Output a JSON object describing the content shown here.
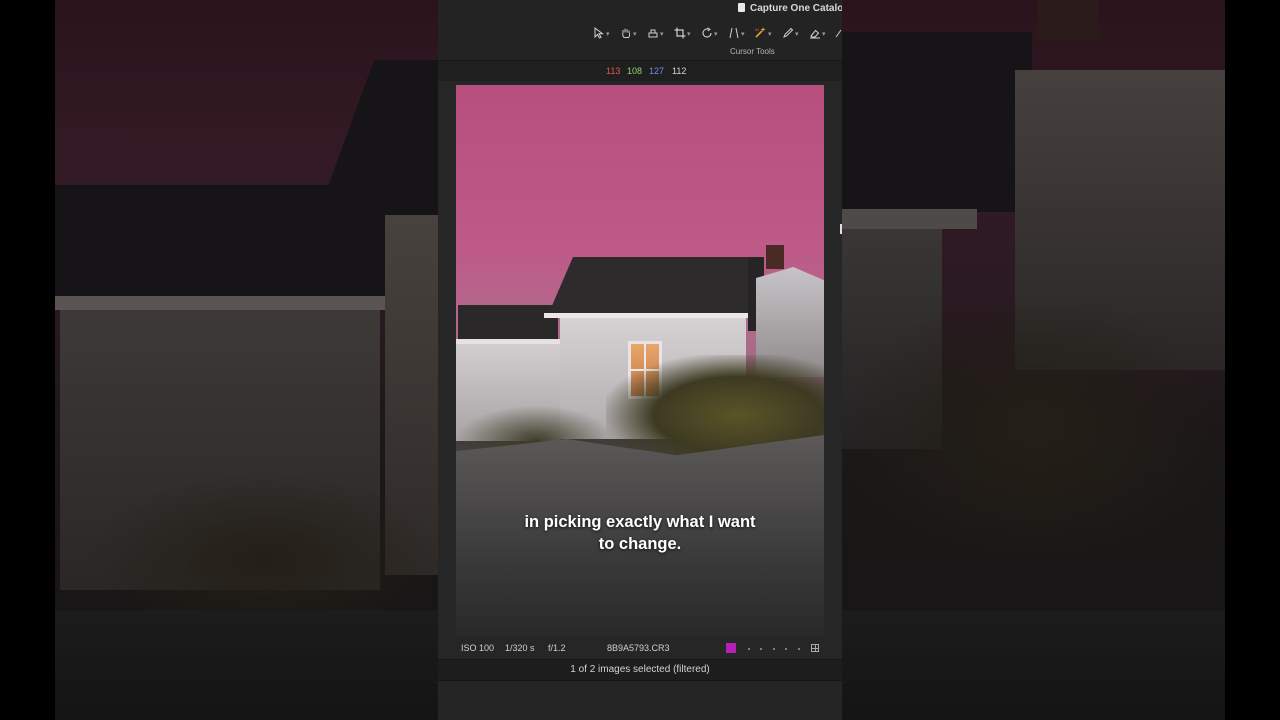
{
  "app": {
    "window_title": "Capture One Catalo"
  },
  "toolbar": {
    "caption": "Cursor Tools",
    "tools": [
      {
        "name": "select-cursor-icon"
      },
      {
        "name": "pan-hand-icon"
      },
      {
        "name": "stamp-icon"
      },
      {
        "name": "crop-icon"
      },
      {
        "name": "rotate-icon"
      },
      {
        "name": "keystone-icon"
      },
      {
        "name": "ai-magic-wand-icon"
      },
      {
        "name": "brush-icon"
      },
      {
        "name": "eraser-icon"
      }
    ]
  },
  "readout": {
    "r": "113",
    "g": "108",
    "b": "127",
    "l": "112",
    "colors": {
      "r": "#e0574f",
      "g": "#8cd66a",
      "b": "#6f8ee6",
      "l": "#d6d6d6"
    }
  },
  "photo": {
    "subtitle_line1": "in picking exactly what I want",
    "subtitle_line2": "to change."
  },
  "image_info": {
    "iso": "ISO 100",
    "shutter": "1/320 s",
    "aperture": "f/1.2",
    "filename": "8B9A5793.CR3",
    "color_tag": "#b61fb4"
  },
  "status": {
    "selection_text": "1 of 2 images selected (filtered)"
  }
}
